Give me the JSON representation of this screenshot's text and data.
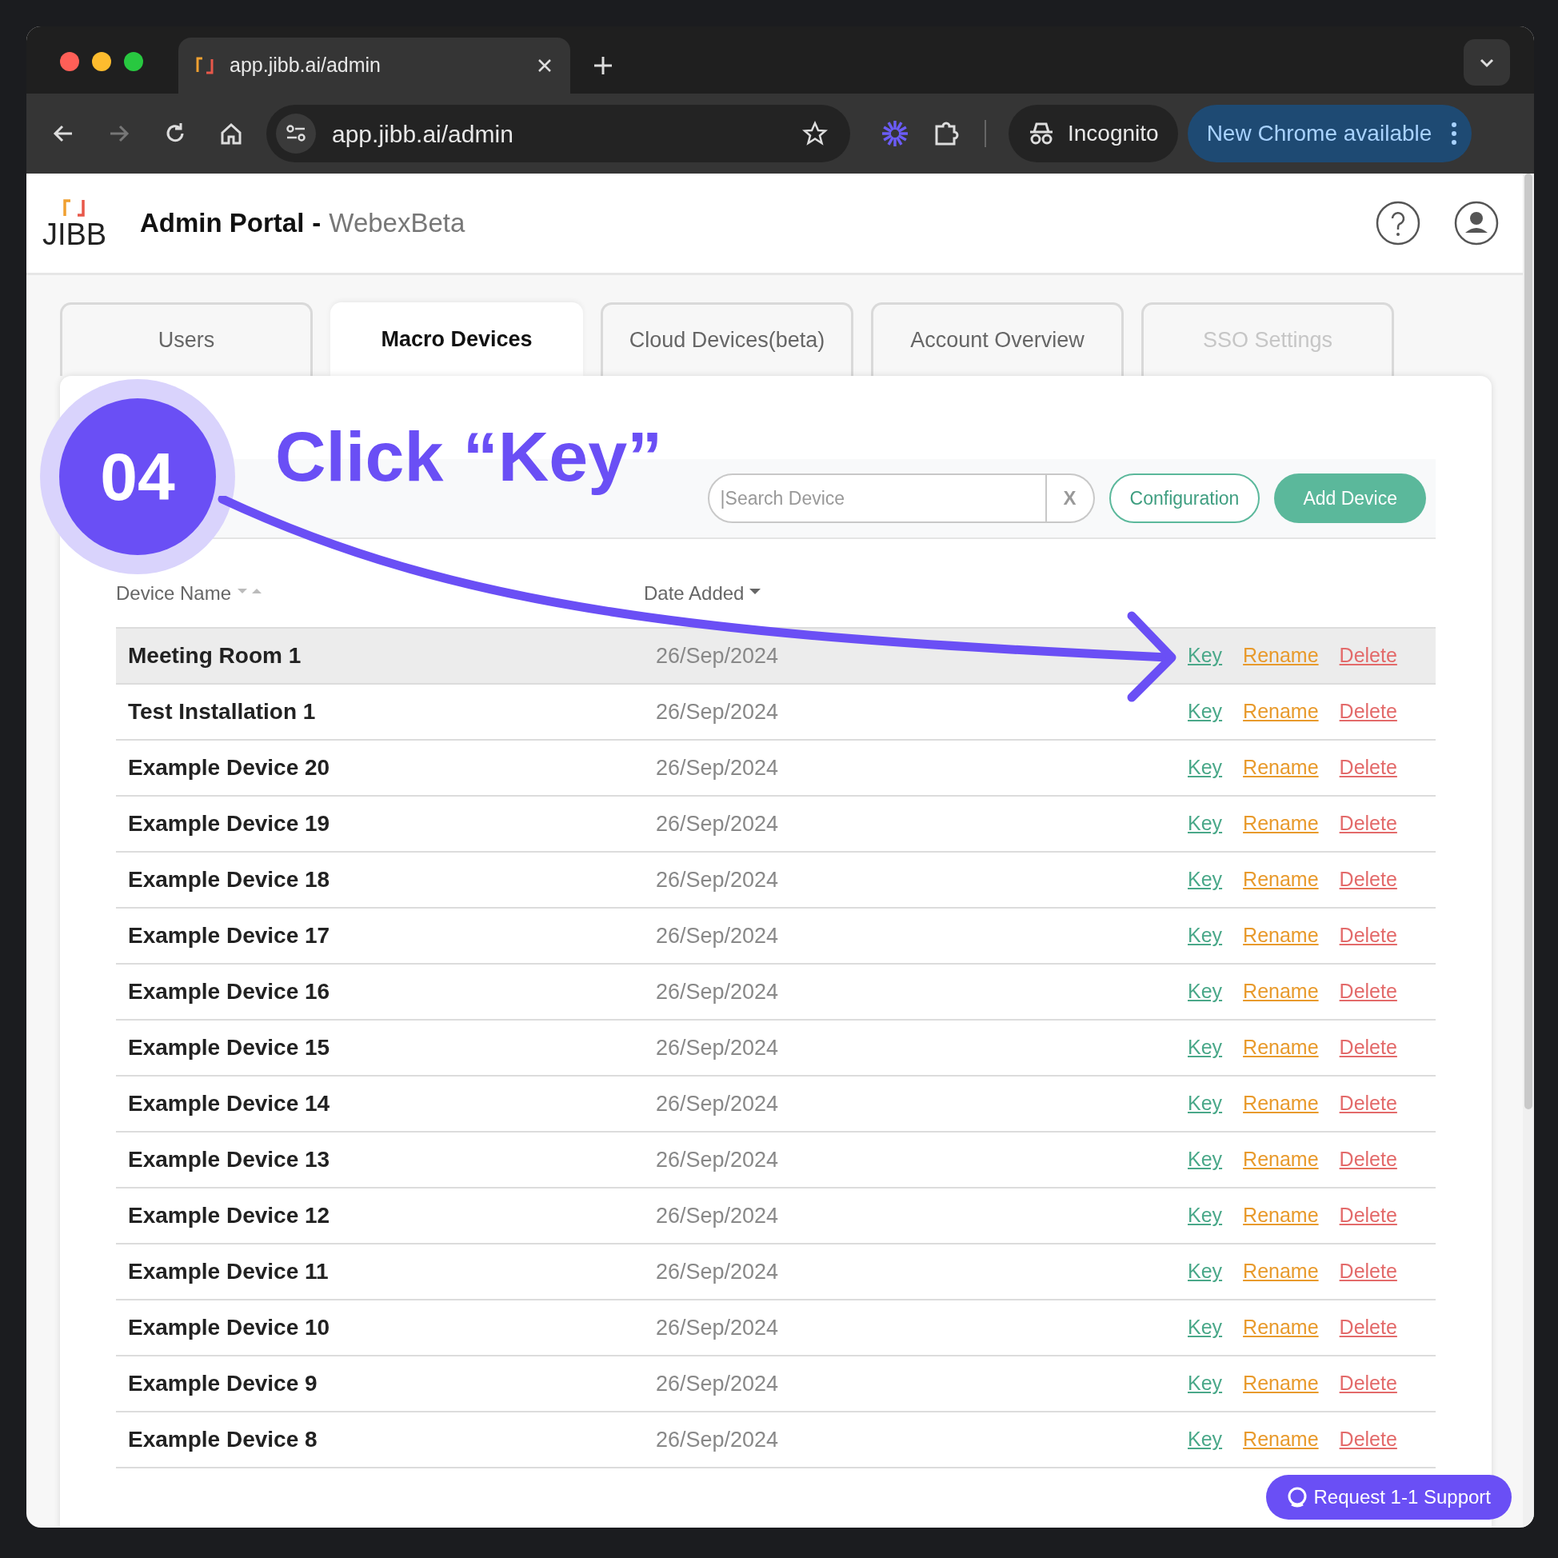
{
  "browser": {
    "tab_title": "app.jibb.ai/admin",
    "url": "app.jibb.ai/admin",
    "profile": "Incognito",
    "update_button": "New Chrome available"
  },
  "header": {
    "logo": "JIBB",
    "title": "Admin Portal",
    "separator": "-",
    "org": "WebexBeta"
  },
  "tabs": [
    {
      "label": "Users",
      "selected": false,
      "disabled": false
    },
    {
      "label": "Macro Devices",
      "selected": true,
      "disabled": false
    },
    {
      "label": "Cloud Devices(beta)",
      "selected": false,
      "disabled": false
    },
    {
      "label": "Account Overview",
      "selected": false,
      "disabled": false
    },
    {
      "label": "SSO Settings",
      "selected": false,
      "disabled": true
    }
  ],
  "toolbar": {
    "search_placeholder": "|Search Device",
    "clear_button": "X",
    "config_button": "Configuration",
    "add_button": "Add Device"
  },
  "columns": [
    {
      "label": "Device Name"
    },
    {
      "label": "Date Added"
    }
  ],
  "rows": [
    {
      "name": "Meeting Room 1",
      "date": "26/Sep/2024",
      "selected": true,
      "key": "Key",
      "rename": "Rename",
      "delete": "Delete"
    },
    {
      "name": "Test Installation 1",
      "date": "26/Sep/2024",
      "selected": false,
      "key": "Key",
      "rename": "Rename",
      "delete": "Delete"
    },
    {
      "name": "Example Device 20",
      "date": "26/Sep/2024",
      "selected": false,
      "key": "Key",
      "rename": "Rename",
      "delete": "Delete"
    },
    {
      "name": "Example Device 19",
      "date": "26/Sep/2024",
      "selected": false,
      "key": "Key",
      "rename": "Rename",
      "delete": "Delete"
    },
    {
      "name": "Example Device 18",
      "date": "26/Sep/2024",
      "selected": false,
      "key": "Key",
      "rename": "Rename",
      "delete": "Delete"
    },
    {
      "name": "Example Device 17",
      "date": "26/Sep/2024",
      "selected": false,
      "key": "Key",
      "rename": "Rename",
      "delete": "Delete"
    },
    {
      "name": "Example Device 16",
      "date": "26/Sep/2024",
      "selected": false,
      "key": "Key",
      "rename": "Rename",
      "delete": "Delete"
    },
    {
      "name": "Example Device 15",
      "date": "26/Sep/2024",
      "selected": false,
      "key": "Key",
      "rename": "Rename",
      "delete": "Delete"
    },
    {
      "name": "Example Device 14",
      "date": "26/Sep/2024",
      "selected": false,
      "key": "Key",
      "rename": "Rename",
      "delete": "Delete"
    },
    {
      "name": "Example Device 13",
      "date": "26/Sep/2024",
      "selected": false,
      "key": "Key",
      "rename": "Rename",
      "delete": "Delete"
    },
    {
      "name": "Example Device 12",
      "date": "26/Sep/2024",
      "selected": false,
      "key": "Key",
      "rename": "Rename",
      "delete": "Delete"
    },
    {
      "name": "Example Device 11",
      "date": "26/Sep/2024",
      "selected": false,
      "key": "Key",
      "rename": "Rename",
      "delete": "Delete"
    },
    {
      "name": "Example Device 10",
      "date": "26/Sep/2024",
      "selected": false,
      "key": "Key",
      "rename": "Rename",
      "delete": "Delete"
    },
    {
      "name": "Example Device 9",
      "date": "26/Sep/2024",
      "selected": false,
      "key": "Key",
      "rename": "Rename",
      "delete": "Delete"
    },
    {
      "name": "Example Device 8",
      "date": "26/Sep/2024",
      "selected": false,
      "key": "Key",
      "rename": "Rename",
      "delete": "Delete"
    }
  ],
  "support_button": "Request 1-1 Support",
  "annotation": {
    "step": "04",
    "text": "Click “Key”"
  }
}
